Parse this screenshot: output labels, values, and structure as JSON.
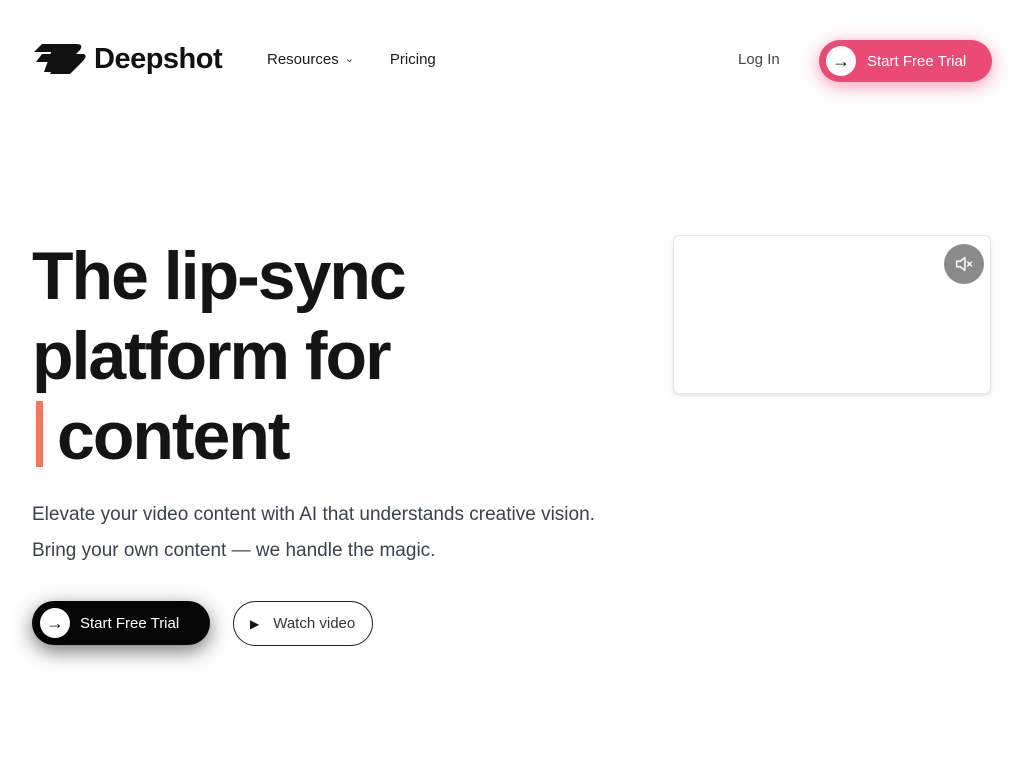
{
  "header": {
    "brand": "Deepshot",
    "nav": {
      "resources": "Resources",
      "pricing": "Pricing"
    },
    "login": "Log In",
    "cta": "Start Free Trial"
  },
  "hero": {
    "title_line1": "The lip-sync",
    "title_line2": "platform for",
    "title_line3": "content",
    "subtitle_line1": "Elevate your video content with AI that understands creative vision.",
    "subtitle_line2": "Bring your own content — we handle the magic.",
    "cta_primary": "Start Free Trial",
    "cta_secondary": "Watch video"
  },
  "icons": {
    "arrow": "arrow-right-icon",
    "play": "play-icon",
    "mute": "speaker-muted-icon",
    "chevron": "chevron-down-icon"
  },
  "colors": {
    "accent_pink": "#e94b75",
    "cursor_orange": "#ee7a5b",
    "text_dark": "#141414",
    "text_muted": "#3a4250"
  }
}
